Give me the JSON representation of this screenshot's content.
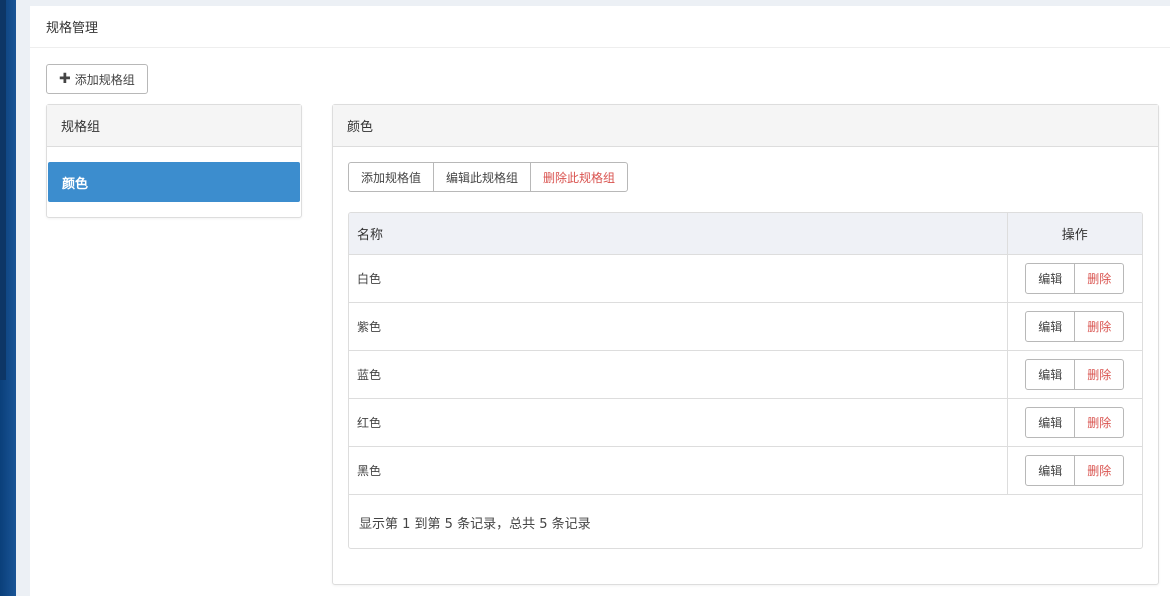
{
  "header": {
    "title": "规格管理"
  },
  "toolbar": {
    "add_group_label": "添加规格组"
  },
  "group_panel": {
    "title": "规格组",
    "items": [
      {
        "label": "颜色",
        "active": true
      }
    ]
  },
  "detail_panel": {
    "title": "颜色",
    "actions": {
      "add_value": "添加规格值",
      "edit_group": "编辑此规格组",
      "delete_group": "删除此规格组"
    },
    "table": {
      "columns": {
        "name": "名称",
        "ops": "操作"
      },
      "edit_label": "编辑",
      "delete_label": "删除",
      "rows": [
        {
          "name": "白色"
        },
        {
          "name": "紫色"
        },
        {
          "name": "蓝色"
        },
        {
          "name": "红色"
        },
        {
          "name": "黑色"
        }
      ],
      "footer": "显示第 1 到第 5 条记录，总共 5 条记录"
    }
  },
  "colors": {
    "accent": "#3c8dce",
    "danger": "#d9534f"
  }
}
